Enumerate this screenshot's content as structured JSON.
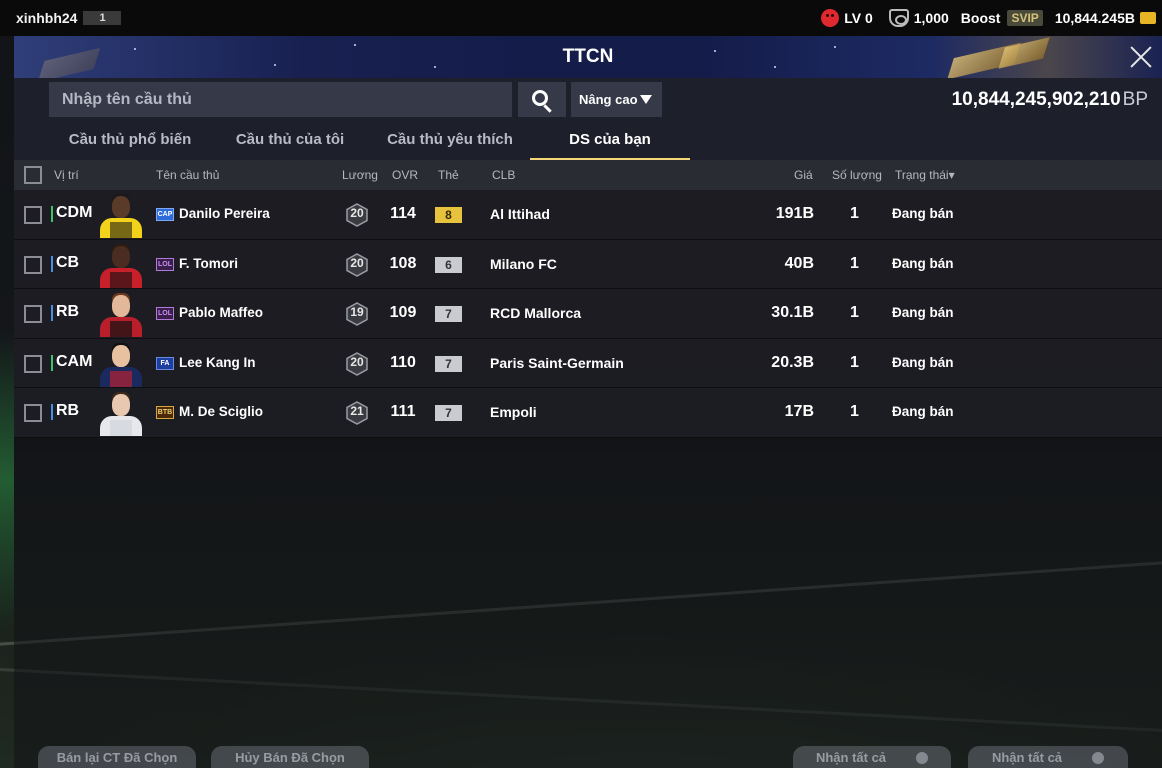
{
  "status": {
    "username": "xinhbh24",
    "user_level": "1",
    "lv_label": "LV 0",
    "currency_amount": "1,000",
    "boost_label": "Boost",
    "svip_label": "SVIP",
    "bp_short": "10,844.245B"
  },
  "header": {
    "title": "TTCN"
  },
  "search": {
    "placeholder": "Nhập tên cầu thủ",
    "advanced_label": "Nâng cao",
    "bp_total": "10,844,245,902,210",
    "bp_unit": "BP"
  },
  "tabs": [
    {
      "label": "Cầu thủ phổ biến",
      "active": false
    },
    {
      "label": "Cầu thủ của tôi",
      "active": false
    },
    {
      "label": "Cầu thủ yêu thích",
      "active": false
    },
    {
      "label": "DS của bạn",
      "active": true
    }
  ],
  "table": {
    "headers": {
      "position": "Vị trí",
      "name": "Tên cầu thủ",
      "wage": "Lương",
      "ovr": "OVR",
      "grade": "Thẻ",
      "club": "CLB",
      "price": "Giá",
      "qty": "Số lượng",
      "state": "Trạng thái▾"
    },
    "rows": [
      {
        "position": "CDM",
        "season": "CAP",
        "name": "Danilo Pereira",
        "wage": "20",
        "ovr": "114",
        "grade": "8",
        "club": "Al Ittihad",
        "price": "191B",
        "qty": "1",
        "state": "Đang bán"
      },
      {
        "position": "CB",
        "season": "LOL",
        "name": "F. Tomori",
        "wage": "20",
        "ovr": "108",
        "grade": "6",
        "club": "Milano FC",
        "price": "40B",
        "qty": "1",
        "state": "Đang bán"
      },
      {
        "position": "RB",
        "season": "LOL",
        "name": "Pablo Maffeo",
        "wage": "19",
        "ovr": "109",
        "grade": "7",
        "club": "RCD Mallorca",
        "price": "30.1B",
        "qty": "1",
        "state": "Đang bán"
      },
      {
        "position": "CAM",
        "season": "FA",
        "name": "Lee Kang In",
        "wage": "20",
        "ovr": "110",
        "grade": "7",
        "club": "Paris Saint-Germain",
        "price": "20.3B",
        "qty": "1",
        "state": "Đang bán"
      },
      {
        "position": "RB",
        "season": "BTB",
        "name": "M. De Sciglio",
        "wage": "21",
        "ovr": "111",
        "grade": "7",
        "club": "Empoli",
        "price": "17B",
        "qty": "1",
        "state": "Đang bán"
      }
    ]
  },
  "footer": {
    "resell_selected": "Bán lại CT Đã Chọn",
    "cancel_selected": "Hủy Bán Đã Chọn",
    "receive_all_1": "Nhận tất cả",
    "receive_all_2": "Nhận tất cả"
  },
  "colors": {
    "accent_gold": "#f4d87a",
    "grade_gold": "#e7c23c",
    "grade_silver": "#c9cbd1",
    "pos_green": "#3ec46d",
    "pos_blue": "#4a90e2",
    "bp_icon": "#e7b624",
    "sad_icon": "#e0282f"
  },
  "icons": [
    "sad-face-icon",
    "shield-icon",
    "bp-coin-icon",
    "search-icon",
    "close-icon",
    "caret-down-icon"
  ]
}
